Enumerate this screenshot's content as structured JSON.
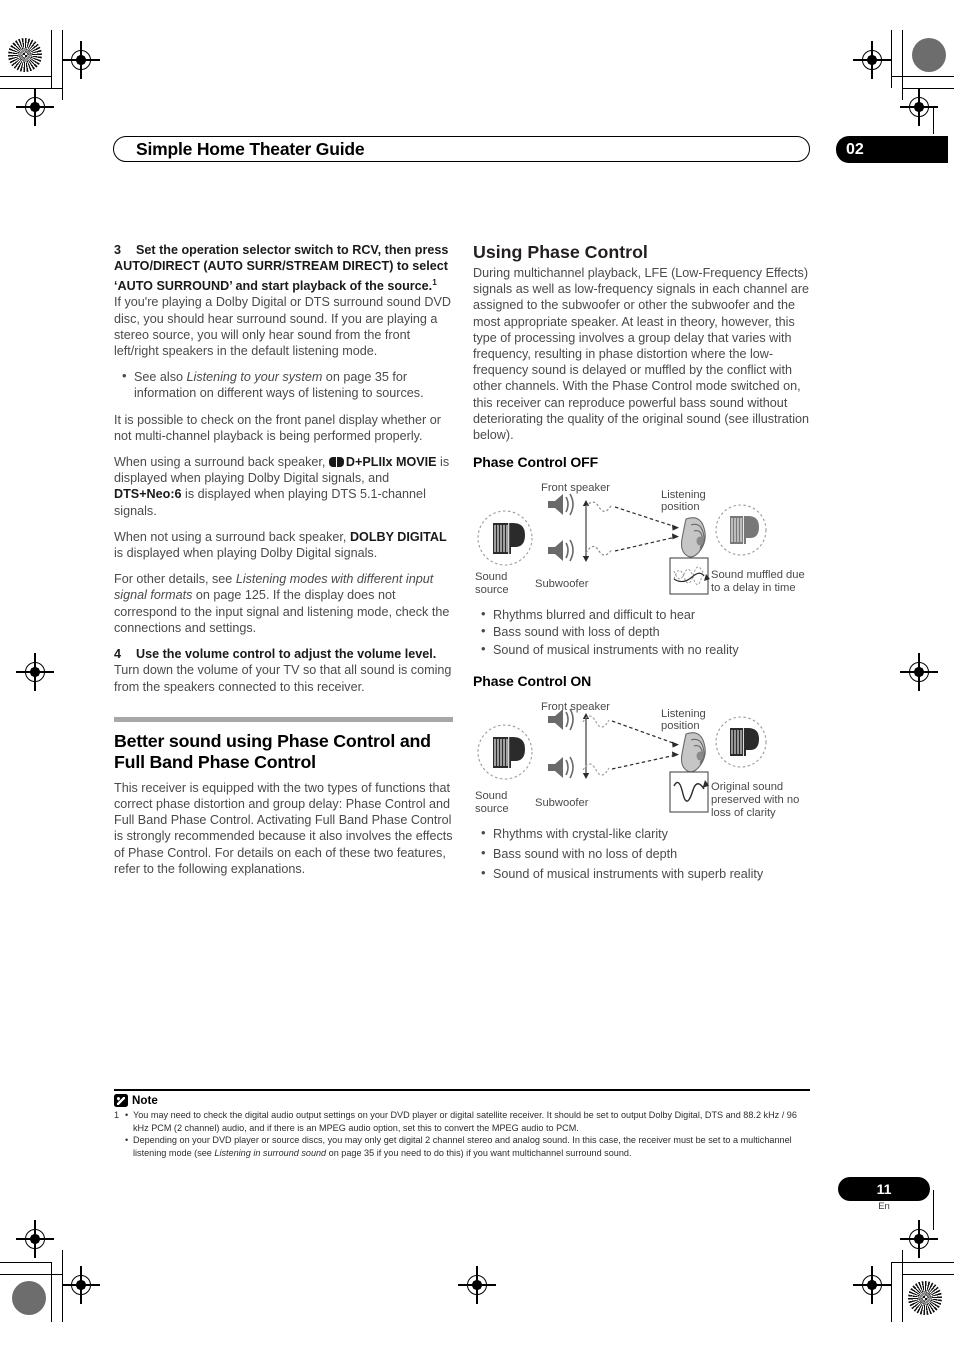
{
  "header": {
    "title": "Simple Home Theater Guide",
    "chapter": "02"
  },
  "left_column": {
    "step3": {
      "number": "3",
      "heading": "Set the operation selector switch to RCV, then press AUTO/DIRECT (AUTO SURR/STREAM DIRECT) to select ‘AUTO SURROUND’ and start playback of the source.",
      "footnote_marker": "1",
      "paragraph": "If you're playing a Dolby Digital or DTS surround sound DVD disc, you should hear surround sound. If you are playing a stereo source, you will only hear sound from the front left/right speakers in the default listening mode.",
      "bullet_prefix": "See also ",
      "bullet_italic": "Listening to your system",
      "bullet_suffix": " on page 35 for information on different ways of listening to sources."
    },
    "paragraph_check": "It is possible to check on the front panel display whether or not multi-channel playback is being performed properly.",
    "paragraph_sb_prefix": "When using a surround back speaker, ",
    "paragraph_sb_bold1": "D+PLIIx MOVIE",
    "paragraph_sb_mid": " is displayed when playing Dolby Digital signals, and ",
    "paragraph_sb_bold2": "DTS+Neo:6",
    "paragraph_sb_suffix": " is displayed when playing DTS 5.1-channel signals.",
    "paragraph_nosb_prefix": "When not using a surround back speaker, ",
    "paragraph_nosb_bold": "DOLBY DIGITAL",
    "paragraph_nosb_suffix": " is displayed when playing Dolby Digital signals.",
    "paragraph_other_prefix": "For other details, see ",
    "paragraph_other_italic": "Listening modes with different input signal formats",
    "paragraph_other_suffix": " on page 125. If the display does not correspond to the input signal and listening mode, check the connections and settings.",
    "step4": {
      "number": "4",
      "heading": "Use the volume control to adjust the volume level.",
      "paragraph": "Turn down the volume of your TV so that all sound is coming from the speakers connected to this receiver."
    },
    "section": {
      "title": "Better sound using Phase Control and Full Band Phase Control",
      "paragraph": "This receiver is equipped with the two types of functions that correct phase distortion and group delay: Phase Control and Full Band Phase Control. Activating Full Band Phase Control is strongly recommended because it also involves the effects of Phase Control. For details on each of these two features, refer to the following explanations."
    }
  },
  "right_column": {
    "section_title": "Using Phase Control",
    "intro": "During multichannel playback, LFE (Low-Frequency Effects) signals as well as low-frequency signals in each channel are assigned to the subwoofer or other the subwoofer and the most appropriate speaker. At least in theory, however, this type of processing involves a group delay that varies with frequency, resulting in phase distortion where the low-frequency sound is delayed or muffled by the conflict with other channels. With the Phase Control mode switched on, this receiver can reproduce powerful bass sound without deteriorating the quality of the original sound (see illustration below).",
    "phase_off": {
      "heading": "Phase Control OFF",
      "labels": {
        "front_speaker": "Front speaker",
        "subwoofer": "Subwoofer",
        "sound_source_line1": "Sound",
        "sound_source_line2": "source",
        "listening_line1": "Listening",
        "listening_line2": "position",
        "result_line1": "Sound muffled due",
        "result_line2": "to a delay in time"
      },
      "bullets": [
        "Rhythms blurred and difficult to hear",
        "Bass sound with loss of depth",
        "Sound of musical instruments with no reality"
      ]
    },
    "phase_on": {
      "heading": "Phase Control ON",
      "labels": {
        "front_speaker": "Front speaker",
        "subwoofer": "Subwoofer",
        "sound_source_line1": "Sound",
        "sound_source_line2": "source",
        "listening_line1": "Listening",
        "listening_line2": "position",
        "result_line1": "Original sound",
        "result_line2": "preserved with no",
        "result_line3": "loss of clarity"
      },
      "bullets": [
        "Rhythms with crystal-like clarity",
        "Bass sound with no loss of depth",
        "Sound of musical instruments with superb reality"
      ]
    }
  },
  "note": {
    "label": "Note",
    "number": "1",
    "items": [
      "You may need to check the digital audio output settings on your DVD player or digital satellite receiver. It should be set to output Dolby Digital, DTS and 88.2 kHz / 96 kHz PCM (2 channel) audio, and if there is an MPEG audio option, set this to convert the MPEG audio to PCM."
    ],
    "item2_prefix": "Depending on your DVD player or source discs, you may only get digital 2 channel stereo and analog sound. In this case, the receiver must be set to a multichannel listening mode (see ",
    "item2_italic": "Listening in surround sound",
    "item2_suffix": " on page 35 if you need to do this) if you want multichannel surround sound."
  },
  "footer": {
    "page_number": "11",
    "language": "En"
  },
  "colors": {
    "accent_black": "#000000",
    "rule_gray": "#a7a7a7",
    "body_gray": "#4a4a4a"
  }
}
